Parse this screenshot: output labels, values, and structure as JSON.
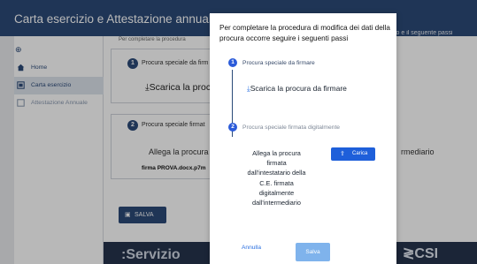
{
  "header": {
    "title": "Carta esercizio e Attestazione annuale",
    "right_fragment": "io e il seguente passi"
  },
  "sidebar": {
    "items": [
      {
        "label": "Home",
        "icon": "home-icon"
      },
      {
        "label": "Carta esercizio",
        "icon": "card-icon"
      },
      {
        "label": "Attestazione Annuale",
        "icon": "attestation-icon"
      }
    ]
  },
  "background": {
    "step1_label": "Procura speciale da firm",
    "download_label": "Scarica la procur",
    "step2_label": "Procura speciale firmat",
    "upload_label": "Allega la procura fir",
    "file_name": "firma PROVA.docx.p7m",
    "intermediario": "rmediario",
    "save_label": "SALVA",
    "footer_brand": "Servizio",
    "footer_csi": "CSI",
    "cutoff_text": "Per completare la procedura"
  },
  "modal": {
    "title": "Per completare la procedura di modifica dei dati della procura occorre seguire i seguenti passi",
    "step1_label": "Procura speciale da firmare",
    "download_link": "Scarica la procura da firmare",
    "step2_label": "Procura speciale firmata digitalmente",
    "upload_description": "Allega la procura firmata dall'intestatario della C.E. firmata digitalmente dall'intermediario",
    "upload_button": "Carica",
    "cancel_link": "Annulla",
    "save_button": "Salva"
  },
  "colors": {
    "header_bg": "#2b4a78",
    "primary": "#1e5fda",
    "save_disabled": "#7fb3ec",
    "footer_bg": "#26344d"
  }
}
